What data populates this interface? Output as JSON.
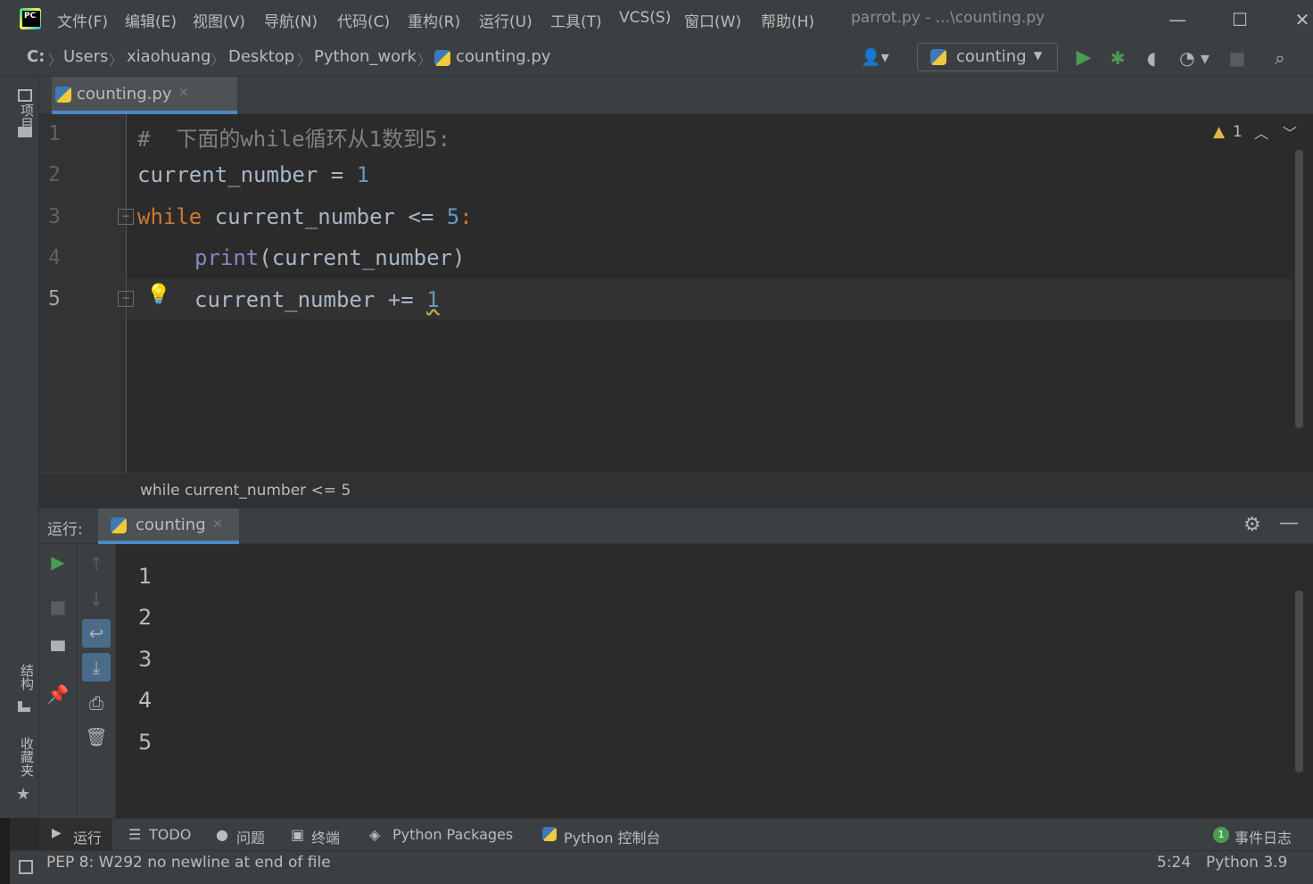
{
  "menu": [
    "文件(F)",
    "编辑(E)",
    "视图(V)",
    "导航(N)",
    "代码(C)",
    "重构(R)",
    "运行(U)",
    "工具(T)",
    "VCS(S)",
    "窗口(W)",
    "帮助(H)"
  ],
  "window_title": "parrot.py - ...\\counting.py",
  "breadcrumb": [
    "C:",
    "Users",
    "xiaohuang",
    "Desktop",
    "Python_work",
    "counting.py"
  ],
  "run_config": "counting",
  "editor_tab": "counting.py",
  "code_lines": [
    {
      "num": "1",
      "text": "#  下面的while循环从1数到5:"
    },
    {
      "num": "2",
      "text": "current_number = 1"
    },
    {
      "num": "3",
      "text": "while current_number <= 5:"
    },
    {
      "num": "4",
      "text": "    print(current_number)"
    },
    {
      "num": "5",
      "text": "    current_number += 1"
    }
  ],
  "code_tokens": {
    "l2_var": "current_number",
    "l2_op": " = ",
    "l2_num": "1",
    "l3_kw": "while",
    "l3_rest": " current_number <= ",
    "l3_num": "5",
    "l3_colon": ":",
    "l4_fn": "print",
    "l4_rest": "(current_number)",
    "l5_rest": "current_number += ",
    "l5_num": "1"
  },
  "warning_count": "1",
  "code_breadcrumb": "while current_number <= 5",
  "left_strip": {
    "project": "项目",
    "structure": "结构",
    "bookmarks": "收藏夹"
  },
  "run_panel": {
    "label": "运行:",
    "tab": "counting",
    "output": [
      "1",
      "2",
      "3",
      "4",
      "5"
    ]
  },
  "tool_windows": [
    "运行",
    "TODO",
    "问题",
    "终端",
    "Python Packages",
    "Python 控制台"
  ],
  "event_log": {
    "count": "1",
    "label": "事件日志"
  },
  "status": {
    "message": "PEP 8: W292 no newline at end of file",
    "position": "5:24",
    "interpreter": "Python 3.9"
  },
  "colors": {
    "keyword": "#cc7832",
    "number": "#6897bb",
    "builtin": "#8888c6",
    "comment": "#808080",
    "text": "#a9b7c6",
    "run_green": "#499c54",
    "accent": "#4a88c7"
  }
}
